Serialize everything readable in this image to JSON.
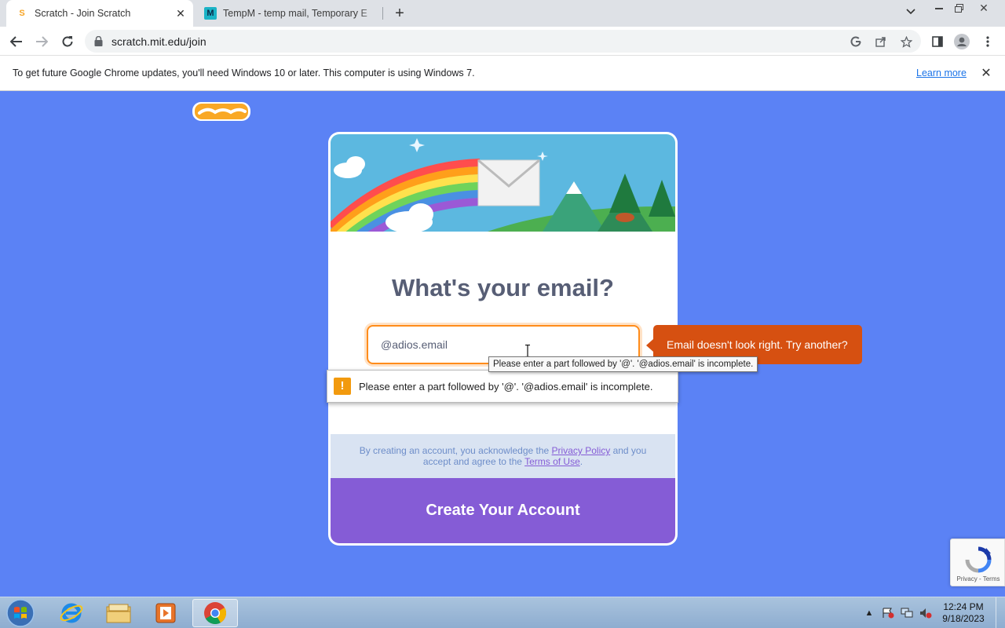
{
  "browser": {
    "tabs": [
      {
        "title": "Scratch - Join Scratch",
        "active": true
      },
      {
        "title": "TempM - temp mail, Temporary E",
        "active": false
      }
    ],
    "favicons": {
      "scratch": "S",
      "tempm": "M"
    },
    "new_tab_label": "+",
    "url": "scratch.mit.edu/join",
    "omnibox_icons": [
      "google-lens-icon",
      "share-icon",
      "star-icon"
    ],
    "toolbar_icons": [
      "side-panel-icon",
      "profile-icon",
      "menu-icon"
    ]
  },
  "infobar": {
    "message": "To get future Google Chrome updates, you'll need Windows 10 or later. This computer is using Windows 7.",
    "link": "Learn more"
  },
  "scratch": {
    "heading": "What's your email?",
    "email_value": "@adios.email",
    "error_bubble": "Email doesn't look right. Try another?",
    "tooltip": "Please enter a part followed by '@'. '@adios.email' is incomplete.",
    "validation_message": "Please enter a part followed by '@'. '@adios.email' is incomplete.",
    "legal_prefix": "By creating an account, you acknowledge the ",
    "privacy_link": "Privacy Policy",
    "legal_middle": " and you accept and agree to the ",
    "terms_link": "Terms of Use",
    "legal_suffix": ".",
    "create_button": "Create Your Account",
    "recaptcha_links": "Privacy - Terms"
  },
  "taskbar": {
    "apps": [
      "internet-explorer",
      "file-explorer",
      "media-player",
      "chrome"
    ],
    "time": "12:24 PM",
    "date": "9/18/2023"
  },
  "colors": {
    "page_bg": "#5b82f5",
    "create_button": "#855cd6",
    "error_bubble": "#d65011",
    "input_border": "#ff8c1a"
  }
}
